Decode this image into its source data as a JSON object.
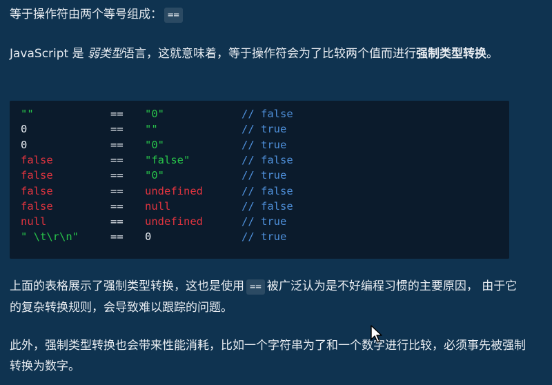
{
  "intro": {
    "text": "等于操作符由两个等号组成：",
    "code": "=="
  },
  "weak_typing": {
    "prefix": "JavaScript 是 ",
    "emphasis": "弱类型",
    "middle": "语言，这就意味着，等于操作符会为了比较两个值而进行",
    "strong": "强制类型转换",
    "suffix": "。"
  },
  "code_rows": [
    {
      "left": "\"\"",
      "left_type": "string",
      "op": "==",
      "right": "\"0\"",
      "right_type": "string",
      "comment": "// false"
    },
    {
      "left": "0",
      "left_type": "number",
      "op": "==",
      "right": "\"\"",
      "right_type": "string",
      "comment": "// true"
    },
    {
      "left": "0",
      "left_type": "number",
      "op": "==",
      "right": "\"0\"",
      "right_type": "string",
      "comment": "// true"
    },
    {
      "left": "false",
      "left_type": "keyword",
      "op": "==",
      "right": "\"false\"",
      "right_type": "string",
      "comment": "// false"
    },
    {
      "left": "false",
      "left_type": "keyword",
      "op": "==",
      "right": "\"0\"",
      "right_type": "string",
      "comment": "// true"
    },
    {
      "left": "false",
      "left_type": "keyword",
      "op": "==",
      "right": "undefined",
      "right_type": "keyword",
      "comment": "// false"
    },
    {
      "left": "false",
      "left_type": "keyword",
      "op": "==",
      "right": "null",
      "right_type": "keyword",
      "comment": "// false"
    },
    {
      "left": "null",
      "left_type": "keyword",
      "op": "==",
      "right": "undefined",
      "right_type": "keyword",
      "comment": "// true"
    },
    {
      "left": "\" \\t\\r\\n\"",
      "left_type": "string",
      "op": "==",
      "right": "0",
      "right_type": "number",
      "comment": "// true"
    }
  ],
  "table_note": {
    "before": "上面的表格展示了强制类型转换，这也是使用",
    "code": "==",
    "after": "被广泛认为是不好编程习惯的主要原因， 由于它的复杂转换规则，会导致难以跟踪的问题。"
  },
  "performance_note": {
    "text": "此外，强制类型转换也会带来性能消耗，比如一个字符串为了和一个数字进行比较，必须事先被强制转换为数字。"
  },
  "colors": {
    "background": "#0f3350",
    "code_background": "#0b1b2c",
    "string": "#28c34a",
    "keyword": "#e0343f",
    "comment": "#4e8fd9",
    "text": "#e9edf2"
  },
  "icons": {
    "cursor": "mouse-pointer-icon"
  }
}
